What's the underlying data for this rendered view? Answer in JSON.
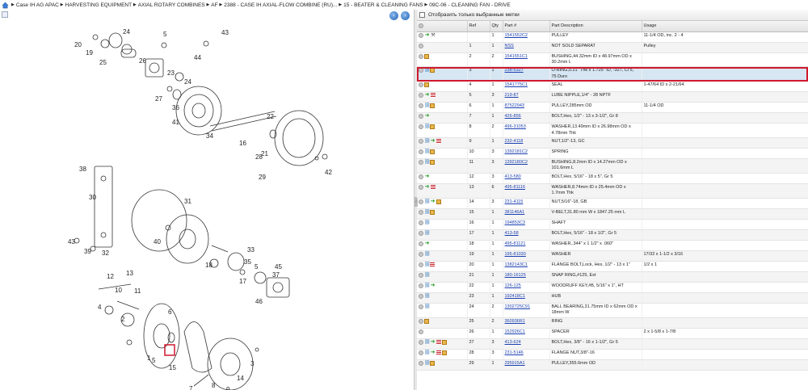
{
  "breadcrumb": [
    "Case IH AG APAC",
    "HARVESTING EQUIPMENT",
    "AXIAL ROTARY COMBINES",
    "AF",
    "2388 - CASE IH AXIAL-FLOW COMBINE (RU)...",
    "15 - BEATER & CLEANING FANS",
    "09C-06 - CLEANING FAN - DRIVE"
  ],
  "filter_label": "Отобразить только выбранные метки",
  "columns": [
    "",
    "Ref",
    "Qty",
    "Part #",
    "Part Description",
    "Usage"
  ],
  "diagram_labels": [
    "20",
    "19",
    "24",
    "25",
    "26",
    "5",
    "43",
    "44",
    "23",
    "24",
    "27",
    "36",
    "22",
    "41",
    "34",
    "16",
    "21",
    "28",
    "38",
    "30",
    "31",
    "40",
    "43",
    "39",
    "32",
    "33",
    "35",
    "18",
    "5",
    "17",
    "37",
    "45",
    "46",
    "12",
    "13",
    "10",
    "11",
    "4",
    "2",
    "6",
    "15",
    "8",
    "7",
    "1",
    "5",
    "9",
    "3",
    "14",
    "42",
    "29"
  ],
  "rows": [
    {
      "icons": [
        "circ",
        "go",
        "wrench"
      ],
      "ref": "",
      "qty": "1",
      "part": "1541552C2",
      "desc": "PULLEY",
      "usage": "11-1/4 OD, inc. 2 - 4"
    },
    {
      "icons": [
        "circ"
      ],
      "ref": "1",
      "qty": "1",
      "part": "NSS",
      "desc": "NOT SOLD SEPARAT",
      "usage": "Pulley"
    },
    {
      "icons": [
        "circ",
        "box"
      ],
      "ref": "2",
      "qty": "2",
      "part": "1541551C1",
      "desc": "BUSHING,44.32mm ID x 48.97mm OD x 30.2mm L",
      "usage": ""
    },
    {
      "icons": [
        "circ",
        "chain",
        "box"
      ],
      "ref": "3",
      "qty": "1",
      "part": "238-5327",
      "desc": "O-RING,0.21\" Thk x 1.725\" ID, -327, Cl 5, 75 Duro",
      "usage": "",
      "selected": true
    },
    {
      "icons": [
        "circ",
        "box"
      ],
      "ref": "4",
      "qty": "1",
      "part": "1541775C1",
      "desc": "SEAL",
      "usage": "1-47/64 ID x 2-21/64"
    },
    {
      "icons": [
        "circ",
        "go",
        "list"
      ],
      "ref": "5",
      "qty": "3",
      "part": "219-87",
      "desc": "LUBE NIPPLE,1/4\" - 28 NPTF",
      "usage": ""
    },
    {
      "icons": [
        "circ",
        "chain",
        "box"
      ],
      "ref": "6",
      "qty": "1",
      "part": "87522943",
      "desc": "PULLEY,285mm OD",
      "usage": "11-1/4 OD"
    },
    {
      "icons": [
        "circ",
        "go"
      ],
      "ref": "7",
      "qty": "1",
      "part": "426-856",
      "desc": "BOLT,Hex, 1/2\" - 13 x 3-1/2\", Gr 8",
      "usage": ""
    },
    {
      "icons": [
        "circ",
        "chain",
        "box"
      ],
      "ref": "8",
      "qty": "2",
      "part": "496-31053",
      "desc": "WASHER,13.49mm ID x 26.98mm OD x 4.78mm Thk",
      "usage": ""
    },
    {
      "icons": [
        "circ",
        "chain",
        "go",
        "list"
      ],
      "ref": "9",
      "qty": "1",
      "part": "232-4118",
      "desc": "NUT,1/2\"-13, GC",
      "usage": ""
    },
    {
      "icons": [
        "circ",
        "chain",
        "box"
      ],
      "ref": "10",
      "qty": "3",
      "part": "1392181C2",
      "desc": "SPRING",
      "usage": ""
    },
    {
      "icons": [
        "circ",
        "chain",
        "box"
      ],
      "ref": "11",
      "qty": "3",
      "part": "1392180C2",
      "desc": "BUSHING,8.2mm ID x 14.27mm OD x 101.6mm L",
      "usage": ""
    },
    {
      "icons": [
        "circ",
        "go"
      ],
      "ref": "12",
      "qty": "3",
      "part": "413-580",
      "desc": "BOLT,Hex, 5/16\" - 18 x 5\", Gr 5",
      "usage": ""
    },
    {
      "icons": [
        "circ",
        "go",
        "list"
      ],
      "ref": "13",
      "qty": "6",
      "part": "495-81116",
      "desc": "WASHER,8.74mm ID x 25.4mm OD x 1.7mm Thk",
      "usage": ""
    },
    {
      "icons": [
        "circ",
        "chain",
        "go",
        "box"
      ],
      "ref": "14",
      "qty": "3",
      "part": "231-4115",
      "desc": "NUT,5/16\"-18, GB",
      "usage": ""
    },
    {
      "icons": [
        "circ",
        "chain",
        "box"
      ],
      "ref": "15",
      "qty": "1",
      "part": "381146A1",
      "desc": "V-BELT,31.80 mm W x 1847.25 mm L",
      "usage": ""
    },
    {
      "icons": [
        "circ",
        "chain"
      ],
      "ref": "16",
      "qty": "1",
      "part": "194853C3",
      "desc": "SHAFT",
      "usage": ""
    },
    {
      "icons": [
        "circ",
        "chain"
      ],
      "ref": "17",
      "qty": "1",
      "part": "413-58",
      "desc": "BOLT,Hex, 5/16\" - 18 x 1/2\", Gr 5",
      "usage": ""
    },
    {
      "icons": [
        "circ",
        "go"
      ],
      "ref": "18",
      "qty": "1",
      "part": "495-81121",
      "desc": "WASHER,.344\" x 1 1/2\" x .060\"",
      "usage": ""
    },
    {
      "icons": [
        "circ",
        "chain"
      ],
      "ref": "19",
      "qty": "1",
      "part": "195-81030",
      "desc": "WASHER",
      "usage": "17/32 x 1-1/2 x 3/16"
    },
    {
      "icons": [
        "circ",
        "chain",
        "list"
      ],
      "ref": "20",
      "qty": "1",
      "part": "1382143C1",
      "desc": "FLANGE BOLT,Lock, Hex, 1/2\" - 13 x 1\"",
      "usage": "1/2 x 1"
    },
    {
      "icons": [
        "circ",
        "chain"
      ],
      "ref": "21",
      "qty": "1",
      "part": "180-16125",
      "desc": "SNAP RING,#125, Ext",
      "usage": ""
    },
    {
      "icons": [
        "circ",
        "chain",
        "go"
      ],
      "ref": "22",
      "qty": "1",
      "part": "126-125",
      "desc": "WOODRUFF KEY,#B, 5/16\" x 1\", HT",
      "usage": ""
    },
    {
      "icons": [
        "circ",
        "chain"
      ],
      "ref": "23",
      "qty": "1",
      "part": "192418C1",
      "desc": "HUB",
      "usage": ""
    },
    {
      "icons": [
        "circ",
        "chain"
      ],
      "ref": "24",
      "qty": "2",
      "part": "1302725C91",
      "desc": "BALL BEARING,31.75mm ID x 62mm OD x 18mm W",
      "usage": ""
    },
    {
      "icons": [
        "circ",
        "box"
      ],
      "ref": "25",
      "qty": "2",
      "part": "360936R1",
      "desc": "RING",
      "usage": ""
    },
    {
      "icons": [
        "circ"
      ],
      "ref": "26",
      "qty": "1",
      "part": "152926C1",
      "desc": "SPACER",
      "usage": "2 x 1-5/8 x 1-7/8"
    },
    {
      "icons": [
        "circ",
        "chain",
        "go",
        "list",
        "box"
      ],
      "ref": "27",
      "qty": "3",
      "part": "413-624",
      "desc": "BOLT,Hex, 3/8\" - 16 x 1-1/2\", Gr 5",
      "usage": ""
    },
    {
      "icons": [
        "circ",
        "chain",
        "go",
        "list",
        "box"
      ],
      "ref": "28",
      "qty": "3",
      "part": "231-5146",
      "desc": "FLANGE NUT,3/8\"-16",
      "usage": ""
    },
    {
      "icons": [
        "circ",
        "chain",
        "box"
      ],
      "ref": "29",
      "qty": "1",
      "part": "295915A1",
      "desc": "PULLEY,355.6mm OD",
      "usage": ""
    }
  ]
}
